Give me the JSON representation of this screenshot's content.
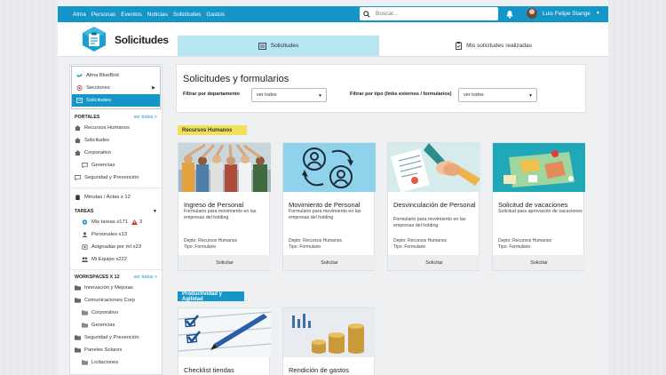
{
  "topnav": [
    "Alma",
    "Personas",
    "Eventos",
    "Noticias",
    "Solicitudes",
    "Gastos"
  ],
  "search": {
    "placeholder": "Buscar..."
  },
  "user": {
    "name": "Luis Felipe Stange"
  },
  "app": {
    "title": "Solicitudes"
  },
  "tabs": {
    "solicitudes": "Solicitudes",
    "mis": "Mis solicitudes realizadas"
  },
  "sidebar": {
    "top": [
      "Alma BlueBird",
      "Secciones",
      "Solicitudes"
    ],
    "portales": {
      "label": "PORTALES",
      "link": "ver todos >",
      "items": [
        "Recursos Humanos",
        "Solicitudes",
        "Corporativo",
        "Gerencias",
        "Seguridad y Prevención"
      ]
    },
    "minutas": "Minutas / Actas x 12",
    "tareas": {
      "label": "TAREAS",
      "mis": "Mis tareas x171",
      "alert": "3",
      "personales": "Personales x13",
      "asignadas": "Asignadas por mí x23",
      "equipo": "Mi Equipo x222"
    },
    "workspaces": {
      "label": "WORKSPACES X 12",
      "link": "ver todos >",
      "items": [
        "Innovación y Mejoras",
        "Comunicaciones Corp",
        "Corporativo",
        "Gerencias",
        "Seguridad y Prevención",
        "Paneles Solares",
        "Licitaciones"
      ]
    }
  },
  "main": {
    "title": "Solicitudes y formularios",
    "filter_dept": "Filtrar por departamento",
    "filter_dept_value": "ver todos",
    "filter_type": "Filtrar por tipo (links externos / formularios)",
    "filter_type_value": "ver todos"
  },
  "categories": [
    {
      "name": "Recursos Humanos",
      "color": "#f3e05a",
      "text_color": "#333"
    },
    {
      "name": "Productividad y Agilidad",
      "color": "#1596c9",
      "text_color": "#ffffff"
    }
  ],
  "cards": [
    {
      "title": "Ingreso de Personal",
      "desc": "Formulario para movimiento en las empresas del holding",
      "depto": "Depto: Recursos Humanos",
      "tipo": "Tipo: Formulario",
      "button": "Solicitar"
    },
    {
      "title": "Movimiento de Personal",
      "desc": "Formulario para movimiento en las empresas del holding",
      "depto": "Depto: Recursos Humanos",
      "tipo": "Tipo: Formulario",
      "button": "Solicitar"
    },
    {
      "title": "Desvinculación de Personal",
      "desc": "Formulario para movimiento en las empresas del holding",
      "depto": "Depto: Recursos Humanos",
      "tipo": "Tipo: Formulario",
      "button": "Solicitar"
    },
    {
      "title": "Solicitud de vacaciones",
      "desc": "Solicitud para aprovación de vacaciones",
      "depto": "Depto: Recursos Humanos",
      "tipo": "Tipo: Formulario",
      "button": "Solicitar"
    },
    {
      "title": "Checklist tiendas",
      "desc": "",
      "depto": "",
      "tipo": "",
      "button": ""
    },
    {
      "title": "Rendición de gastos",
      "desc": "",
      "depto": "",
      "tipo": "",
      "button": ""
    }
  ]
}
